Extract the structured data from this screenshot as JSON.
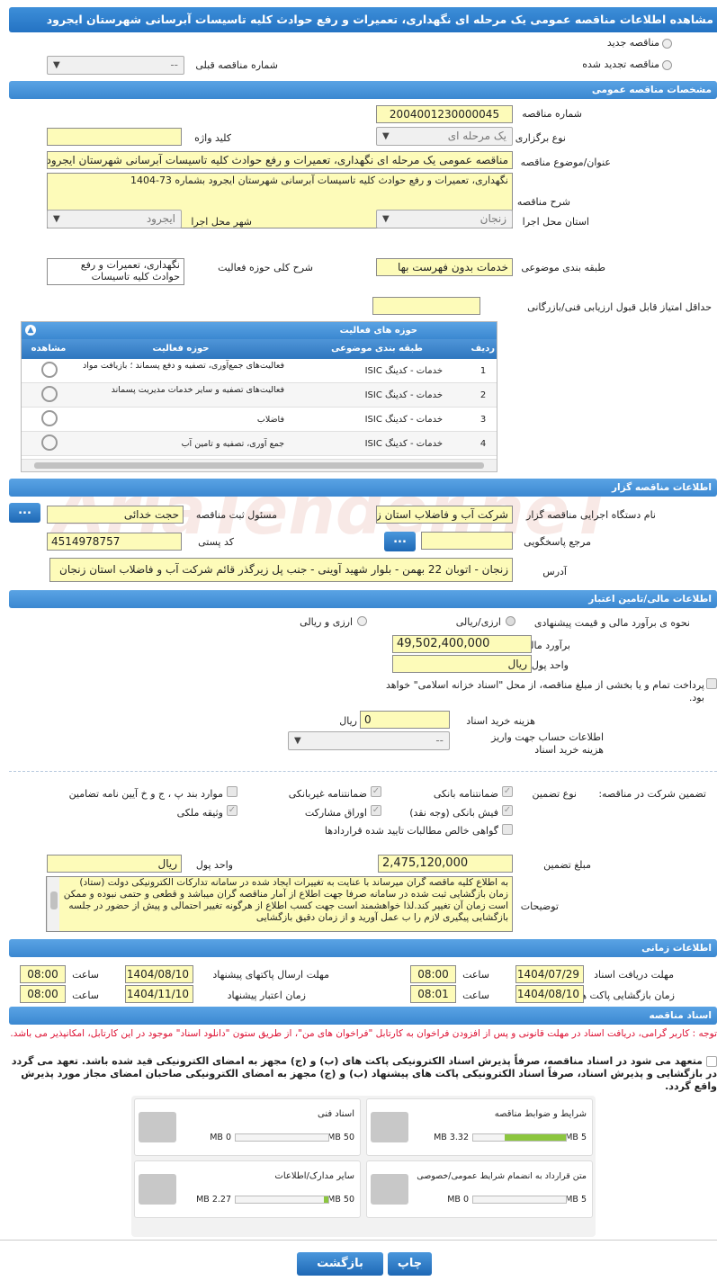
{
  "title": "مشاهده اطلاعات مناقصه عمومی یک مرحله ای نگهداری، تعمیرات و رفع حوادث کلیه تاسیسات آبرسانی شهرستان ایجرود",
  "top": {
    "new_label": "مناقصه جدید",
    "renewed_label": "مناقصه تجدید شده",
    "prev_label": "شماره مناقصه قبلی",
    "prev_value": "--"
  },
  "general": {
    "header": "مشخصات مناقصه عمومی",
    "number_label": "شماره مناقصه",
    "number": "2004001230000045",
    "type_label": "نوع برگزاری",
    "type": "یک مرحله ای",
    "keyword_label": "کلید واژه",
    "keyword": "",
    "subject_label": "عنوان/موضوع مناقصه",
    "subject": "مناقصه عمومی یک مرحله ای نگهداری، تعمیرات و رفع حوادث کلیه تاسیسات آبرسانی شهرستان ایجرود",
    "desc_label": "شرح مناقصه",
    "desc": "نگهداری، تعمیرات و رفع حوادث کلیه تاسیسات آبرسانی شهرستان ایجرود بشماره 73-1404",
    "province_label": "استان محل اجرا",
    "province": "زنجان",
    "city_label": "شهر محل اجرا",
    "city": "ایجرود",
    "category_label": "طبقه بندی موضوعی",
    "category": "خدمات بدون فهرست بها",
    "scope_label": "شرح کلی حوزه فعالیت",
    "scope": "نگهداری، تعمیرات و رفع حوادث کلیه تاسیسات",
    "minscore_label": "حداقل امتیاز قابل قبول ارزیابی فنی/بازرگانی",
    "minscore": ""
  },
  "activities": {
    "header": "حوزه های فعالیت",
    "columns": {
      "row": "ردیف",
      "category": "طبقه بندی موضوعی",
      "field": "حوزه فعالیت",
      "view": "مشاهده"
    },
    "rows": [
      {
        "n": "1",
        "cat": "خدمات - کدینگ ISIC",
        "field": "فعالیت‌های جمع‌آوری، تصفیه و دفع پسماند ؛ بازیافت مواد"
      },
      {
        "n": "2",
        "cat": "خدمات - کدینگ ISIC",
        "field": "فعالیت‌های تصفیه و سایر خدمات مدیریت پسماند"
      },
      {
        "n": "3",
        "cat": "خدمات - کدینگ ISIC",
        "field": "فاضلاب"
      },
      {
        "n": "4",
        "cat": "خدمات - کدینگ ISIC",
        "field": "جمع آوری، تصفیه و تامین آب"
      }
    ]
  },
  "organizer": {
    "header": "اطلاعات مناقصه گزار",
    "org_label": "نام دستگاه اجرایی مناقصه گزار",
    "org": "شرکت آب و فاضلاب استان زنجان",
    "resp_label": "مسئول ثبت مناقصه",
    "resp": "حجت خدائی",
    "dots": "...",
    "ref_label": "مرجع پاسخگویی",
    "ref": "",
    "postal_label": "کد پستی",
    "postal": "4514978757",
    "address_label": "آدرس",
    "address": "زنجان - اتوبان 22 بهمن - بلوار شهید آوینی - جنب پل زیرگذر قائم شرکت آب و فاضلاب استان زنجان"
  },
  "financial": {
    "header": "اطلاعات مالی/تامین اعتبار",
    "method_label": "نحوه ی برآورد مالی و قیمت پیشنهادی",
    "opt1": "ارزی/ریالی",
    "opt2": "ارزی و ریالی",
    "estimate_label": "برآورد مالی",
    "estimate": "49,502,400,000",
    "currency_label": "واحد پول",
    "currency": "ریال",
    "treasury_text": "پرداخت تمام و یا بخشی از مبلغ مناقصه، از محل \"اسناد خزانه اسلامی\" خواهد بود.",
    "docfee_label": "هزینه خرید اسناد",
    "docfee": "0",
    "docfee_unit": "ریال",
    "account_label": "اطلاعات حساب جهت واریز هزینه خرید اسناد",
    "account": "--"
  },
  "guarantee": {
    "label": "تضمین شرکت در مناقصه:",
    "type_label": "نوع تضمین",
    "items": {
      "bank": "ضمانتنامه بانکی",
      "nonbank": "ضمانتنامه غیربانکی",
      "clauses": "موارد بند پ ، ج و خ آیین نامه تضامین",
      "receipt": "فیش بانکی (وجه نقد)",
      "bonds": "اوراق مشارکت",
      "property": "وثیقه ملکی",
      "claims": "گواهی خالص مطالبات تایید شده قراردادها"
    },
    "amount_label": "مبلغ تضمین",
    "amount": "2,475,120,000",
    "unit_label": "واحد پول",
    "unit": "ریال",
    "notes_label": "توضیحات",
    "notes": "به اطلاع کلیه ماقصه گران میرساند با عنایت به تغییرات ایجاد شده در سامانه تدارکات الکترونیکی دولت (ستاد) زمان بازگشایی ثبت شده در سامانه صرفا جهت اطلاع از آمار مناقصه گران میباشد و قطعی و حتمی نبوده و ممکن است زمان آن تغییر کند.لذا خواهشمند است جهت کسب اطلاع از هرگونه تغییر احتمالی و پیش از حضور در جلسه بازگشایی پیگیری لازم را ب عمل آورید و از زمان دقیق بازگشایی"
  },
  "timing": {
    "header": "اطلاعات زمانی",
    "receive_label": "مهلت دریافت اسناد",
    "receive_date": "1404/07/29",
    "receive_time": "08:00",
    "send_label": "مهلت ارسال پاکتهای پیشنهاد",
    "send_date": "1404/08/10",
    "send_time": "08:00",
    "open_label": "زمان بازگشایی پاکت ها",
    "open_date": "1404/08/10",
    "open_time": "08:01",
    "valid_label": "زمان اعتبار پیشنهاد",
    "valid_date": "1404/11/10",
    "valid_time": "08:00",
    "time_label": "ساعت"
  },
  "docs": {
    "header": "اسناد مناقصه",
    "notice": "توجه : کاربر گرامی، دریافت اسناد در مهلت قانونی و پس از افزودن فراخوان به کارتابل \"فراخوان های من\"، از طریق ستون \"دانلود اسناد\" موجود در این کارتابل، امکانپذیر می باشد.",
    "commit": "متعهد می شود در اسناد مناقصه، صرفاً پذیرش اسناد الکترونیکی پاکت های (ب) و (ج) مجهز به امضای الکترونیکی قید شده باشد. تعهد می گردد در بازگشایی و پذیرش اسناد، صرفاً اسناد الکترونیکی پاکت های پیشنهاد (ب) و (ج) مجهز به امضای الکترونیکی صاحبان امضای مجاز مورد پذیرش واقع گردد.",
    "files": [
      {
        "name": "شرایط و ضوابط مناقصه",
        "size": "3.32 MB",
        "max": "5 MB",
        "fill": 0.664
      },
      {
        "name": "اسناد فنی",
        "size": "0 MB",
        "max": "50 MB",
        "fill": 0
      },
      {
        "name": "متن قرارداد به انضمام شرایط عمومی/خصوصی",
        "size": "0 MB",
        "max": "5 MB",
        "fill": 0
      },
      {
        "name": "سایر مدارک/اطلاعات",
        "size": "2.27 MB",
        "max": "50 MB",
        "fill": 0.045
      }
    ]
  },
  "footer": {
    "print": "چاپ",
    "back": "بازگشت"
  },
  "watermark": "AriaTender.neT"
}
